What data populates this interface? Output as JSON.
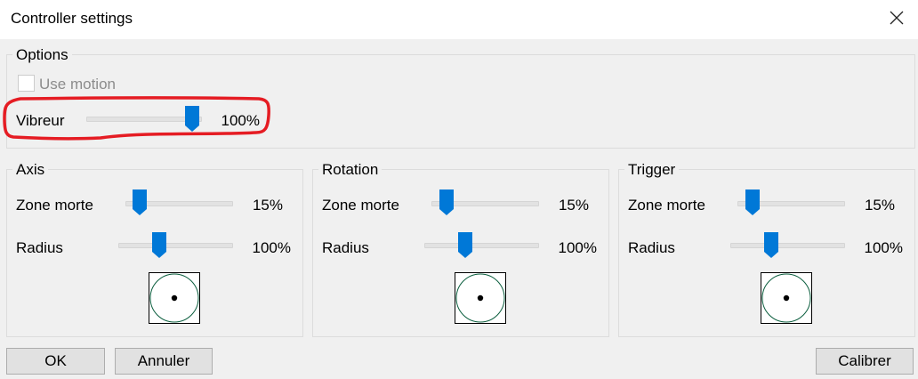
{
  "window": {
    "title": "Controller settings"
  },
  "options": {
    "label": "Options",
    "use_motion": {
      "label": "Use motion",
      "checked": false,
      "enabled": false
    },
    "vibreur": {
      "label": "Vibreur",
      "value": "100%",
      "level": 1.0
    }
  },
  "groups": [
    {
      "label": "Axis",
      "deadzone": {
        "label": "Zone morte",
        "value": "15%"
      },
      "radius": {
        "label": "Radius",
        "value": "100%"
      }
    },
    {
      "label": "Rotation",
      "deadzone": {
        "label": "Zone morte",
        "value": "15%"
      },
      "radius": {
        "label": "Radius",
        "value": "100%"
      }
    },
    {
      "label": "Trigger",
      "deadzone": {
        "label": "Zone morte",
        "value": "15%"
      },
      "radius": {
        "label": "Radius",
        "value": "100%"
      }
    }
  ],
  "buttons": {
    "ok": "OK",
    "cancel": "Annuler",
    "calibrate": "Calibrer"
  },
  "colors": {
    "slider_thumb": "#0078d7",
    "highlight": "#e51c23",
    "preview_circle": "#0b5e3e"
  },
  "icons": {
    "close": "close-icon",
    "thumb": "slider-thumb-icon"
  }
}
